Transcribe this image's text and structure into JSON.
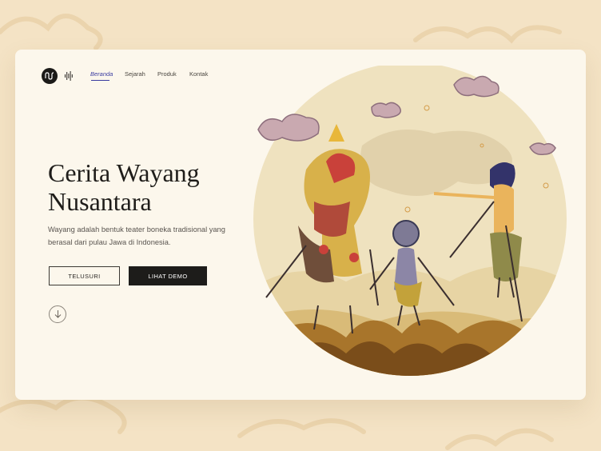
{
  "brand": {
    "logo_text": "ꟽ"
  },
  "nav": {
    "items": [
      {
        "label": "Beranda",
        "active": true
      },
      {
        "label": "Sejarah",
        "active": false
      },
      {
        "label": "Produk",
        "active": false
      },
      {
        "label": "Kontak",
        "active": false
      }
    ]
  },
  "hero": {
    "title_line1": "Cerita Wayang",
    "title_line2": "Nusantara",
    "description": "Wayang adalah bentuk teater boneka tradisional yang berasal dari pulau Jawa di Indonesia.",
    "primary_button": "TELUSURI",
    "secondary_button": "LIHAT DEMO"
  },
  "icons": {
    "logo": "brand-logo-icon",
    "sound": "sound-wave-icon",
    "scroll": "arrow-down-icon"
  },
  "colors": {
    "background": "#f4e3c5",
    "card": "#fcf7ec",
    "accent": "#3a3ba0",
    "dark_button": "#1d1c1a",
    "illustration_circle": "#efe2bf"
  }
}
